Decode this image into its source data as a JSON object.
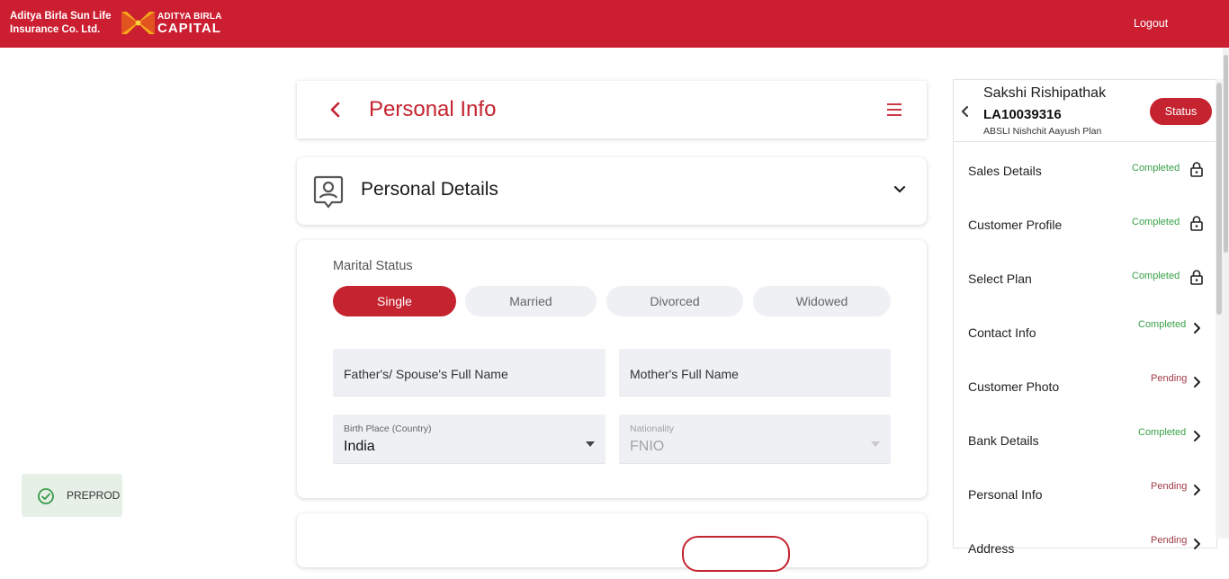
{
  "header": {
    "brand_line1": "Aditya Birla Sun Life",
    "brand_line2": "Insurance Co. Ltd.",
    "logo_top": "ADITYA BIRLA",
    "logo_bottom": "CAPITAL",
    "logout_label": "Logout",
    "brand_color": "#cc1e31"
  },
  "page": {
    "title": "Personal Info",
    "back_icon": "chevron-left-icon",
    "menu_icon": "hamburger-menu-icon"
  },
  "section": {
    "title": "Personal Details",
    "icon": "person-badge-icon",
    "toggle_icon": "chevron-down-icon"
  },
  "form": {
    "marital_label": "Marital Status",
    "marital_options": [
      "Single",
      "Married",
      "Divorced",
      "Widowed"
    ],
    "marital_selected": "Single",
    "father_placeholder": "Father's/ Spouse's Full Name",
    "mother_placeholder": "Mother's Full Name",
    "birthplace_label": "Birth Place (Country)",
    "birthplace_value": "India",
    "nationality_label": "Nationality",
    "nationality_value": "FNIO",
    "accent_color": "#c4232f"
  },
  "env_badge": {
    "label": "PREPROD",
    "icon": "check-circle-icon"
  },
  "panel": {
    "name": "Sakshi Rishipathak",
    "application_id": "LA10039316",
    "plan": "ABSLI Nishchit Aayush Plan",
    "status_button": "Status",
    "steps": [
      {
        "label": "Sales Details",
        "status": "Completed",
        "icon": "lock-icon"
      },
      {
        "label": "Customer Profile",
        "status": "Completed",
        "icon": "lock-icon"
      },
      {
        "label": "Select Plan",
        "status": "Completed",
        "icon": "lock-icon"
      },
      {
        "label": "Contact Info",
        "status": "Completed",
        "icon": "chevron-right-icon"
      },
      {
        "label": "Customer Photo",
        "status": "Pending",
        "icon": "chevron-right-icon"
      },
      {
        "label": "Bank Details",
        "status": "Completed",
        "icon": "chevron-right-icon"
      },
      {
        "label": "Personal Info",
        "status": "Pending",
        "icon": "chevron-right-icon"
      },
      {
        "label": "Address",
        "status": "Pending",
        "icon": "chevron-right-icon"
      }
    ],
    "completed_color": "#38a047",
    "pending_color": "#a03a46"
  }
}
